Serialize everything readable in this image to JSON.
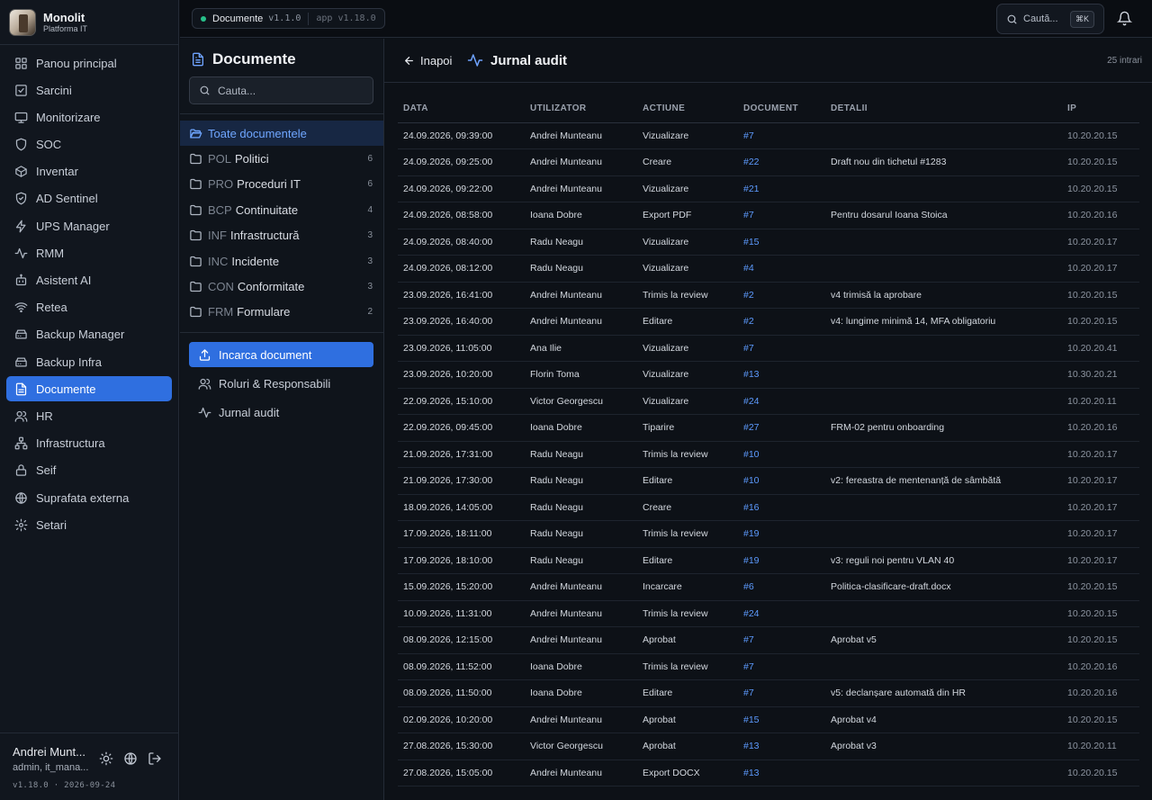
{
  "brand": {
    "title": "Monolit",
    "subtitle": "Platforma IT"
  },
  "sidebar": {
    "items": [
      {
        "label": "Panou principal",
        "icon": "dashboard-icon"
      },
      {
        "label": "Sarcini",
        "icon": "checkbox-icon"
      },
      {
        "label": "Monitorizare",
        "icon": "monitor-icon"
      },
      {
        "label": "SOC",
        "icon": "shield-icon"
      },
      {
        "label": "Inventar",
        "icon": "box-icon"
      },
      {
        "label": "AD Sentinel",
        "icon": "shield-check-icon"
      },
      {
        "label": "UPS Manager",
        "icon": "bolt-icon"
      },
      {
        "label": "RMM",
        "icon": "pulse-icon"
      },
      {
        "label": "Asistent AI",
        "icon": "bot-icon"
      },
      {
        "label": "Retea",
        "icon": "wifi-icon"
      },
      {
        "label": "Backup Manager",
        "icon": "drive-icon"
      },
      {
        "label": "Backup Infra",
        "icon": "drive-icon"
      },
      {
        "label": "Documente",
        "icon": "document-icon",
        "active": true
      },
      {
        "label": "HR",
        "icon": "users-icon"
      },
      {
        "label": "Infrastructura",
        "icon": "network-icon"
      },
      {
        "label": "Seif",
        "icon": "lock-icon"
      },
      {
        "label": "Suprafata externa",
        "icon": "globe-icon"
      },
      {
        "label": "Setari",
        "icon": "gear-icon"
      }
    ]
  },
  "user": {
    "name": "Andrei Munt...",
    "role": "admin, it_mana...",
    "version": "v1.18.0 · 2026-09-24"
  },
  "topbar": {
    "module": "Documente",
    "module_version": "v1.1.0",
    "app_version": "app v1.18.0",
    "search_placeholder": "Caută...",
    "search_shortcut": "⌘K"
  },
  "docs": {
    "title": "Documente",
    "search_placeholder": "Cauta...",
    "categories": [
      {
        "code": "",
        "label": "Toate documentele",
        "count": "",
        "active": true
      },
      {
        "code": "POL",
        "label": "Politici",
        "count": "6"
      },
      {
        "code": "PRO",
        "label": "Proceduri IT",
        "count": "6"
      },
      {
        "code": "BCP",
        "label": "Continuitate",
        "count": "4"
      },
      {
        "code": "INF",
        "label": "Infrastructură",
        "count": "3"
      },
      {
        "code": "INC",
        "label": "Incidente",
        "count": "3"
      },
      {
        "code": "CON",
        "label": "Conformitate",
        "count": "3"
      },
      {
        "code": "FRM",
        "label": "Formulare",
        "count": "2"
      }
    ],
    "actions": {
      "upload": "Incarca document",
      "roles": "Roluri & Responsabili",
      "audit": "Jurnal audit"
    }
  },
  "main": {
    "back_label": "Inapoi",
    "title": "Jurnal audit",
    "entries_count": "25 intrari",
    "columns": [
      "DATA",
      "UTILIZATOR",
      "ACTIUNE",
      "DOCUMENT",
      "DETALII",
      "IP"
    ],
    "rows": [
      [
        "24.09.2026, 09:39:00",
        "Andrei Munteanu",
        "Vizualizare",
        "#7",
        "",
        "10.20.20.15"
      ],
      [
        "24.09.2026, 09:25:00",
        "Andrei Munteanu",
        "Creare",
        "#22",
        "Draft nou din tichetul #1283",
        "10.20.20.15"
      ],
      [
        "24.09.2026, 09:22:00",
        "Andrei Munteanu",
        "Vizualizare",
        "#21",
        "",
        "10.20.20.15"
      ],
      [
        "24.09.2026, 08:58:00",
        "Ioana Dobre",
        "Export PDF",
        "#7",
        "Pentru dosarul Ioana Stoica",
        "10.20.20.16"
      ],
      [
        "24.09.2026, 08:40:00",
        "Radu Neagu",
        "Vizualizare",
        "#15",
        "",
        "10.20.20.17"
      ],
      [
        "24.09.2026, 08:12:00",
        "Radu Neagu",
        "Vizualizare",
        "#4",
        "",
        "10.20.20.17"
      ],
      [
        "23.09.2026, 16:41:00",
        "Andrei Munteanu",
        "Trimis la review",
        "#2",
        "v4 trimisă la aprobare",
        "10.20.20.15"
      ],
      [
        "23.09.2026, 16:40:00",
        "Andrei Munteanu",
        "Editare",
        "#2",
        "v4: lungime minimă 14, MFA obligatoriu",
        "10.20.20.15"
      ],
      [
        "23.09.2026, 11:05:00",
        "Ana Ilie",
        "Vizualizare",
        "#7",
        "",
        "10.20.20.41"
      ],
      [
        "23.09.2026, 10:20:00",
        "Florin Toma",
        "Vizualizare",
        "#13",
        "",
        "10.30.20.21"
      ],
      [
        "22.09.2026, 15:10:00",
        "Victor Georgescu",
        "Vizualizare",
        "#24",
        "",
        "10.20.20.11"
      ],
      [
        "22.09.2026, 09:45:00",
        "Ioana Dobre",
        "Tiparire",
        "#27",
        "FRM-02 pentru onboarding",
        "10.20.20.16"
      ],
      [
        "21.09.2026, 17:31:00",
        "Radu Neagu",
        "Trimis la review",
        "#10",
        "",
        "10.20.20.17"
      ],
      [
        "21.09.2026, 17:30:00",
        "Radu Neagu",
        "Editare",
        "#10",
        "v2: fereastra de mentenanță de sâmbătă",
        "10.20.20.17"
      ],
      [
        "18.09.2026, 14:05:00",
        "Radu Neagu",
        "Creare",
        "#16",
        "",
        "10.20.20.17"
      ],
      [
        "17.09.2026, 18:11:00",
        "Radu Neagu",
        "Trimis la review",
        "#19",
        "",
        "10.20.20.17"
      ],
      [
        "17.09.2026, 18:10:00",
        "Radu Neagu",
        "Editare",
        "#19",
        "v3: reguli noi pentru VLAN 40",
        "10.20.20.17"
      ],
      [
        "15.09.2026, 15:20:00",
        "Andrei Munteanu",
        "Incarcare",
        "#6",
        "Politica-clasificare-draft.docx",
        "10.20.20.15"
      ],
      [
        "10.09.2026, 11:31:00",
        "Andrei Munteanu",
        "Trimis la review",
        "#24",
        "",
        "10.20.20.15"
      ],
      [
        "08.09.2026, 12:15:00",
        "Andrei Munteanu",
        "Aprobat",
        "#7",
        "Aprobat v5",
        "10.20.20.15"
      ],
      [
        "08.09.2026, 11:52:00",
        "Ioana Dobre",
        "Trimis la review",
        "#7",
        "",
        "10.20.20.16"
      ],
      [
        "08.09.2026, 11:50:00",
        "Ioana Dobre",
        "Editare",
        "#7",
        "v5: declanșare automată din HR",
        "10.20.20.16"
      ],
      [
        "02.09.2026, 10:20:00",
        "Andrei Munteanu",
        "Aprobat",
        "#15",
        "Aprobat v4",
        "10.20.20.15"
      ],
      [
        "27.08.2026, 15:30:00",
        "Victor Georgescu",
        "Aprobat",
        "#13",
        "Aprobat v3",
        "10.20.20.11"
      ],
      [
        "27.08.2026, 15:05:00",
        "Andrei Munteanu",
        "Export DOCX",
        "#13",
        "",
        "10.20.20.15"
      ]
    ]
  },
  "colors": {
    "accent": "#2f6fe0",
    "link": "#5d9bff",
    "status_online": "#27c08a"
  }
}
